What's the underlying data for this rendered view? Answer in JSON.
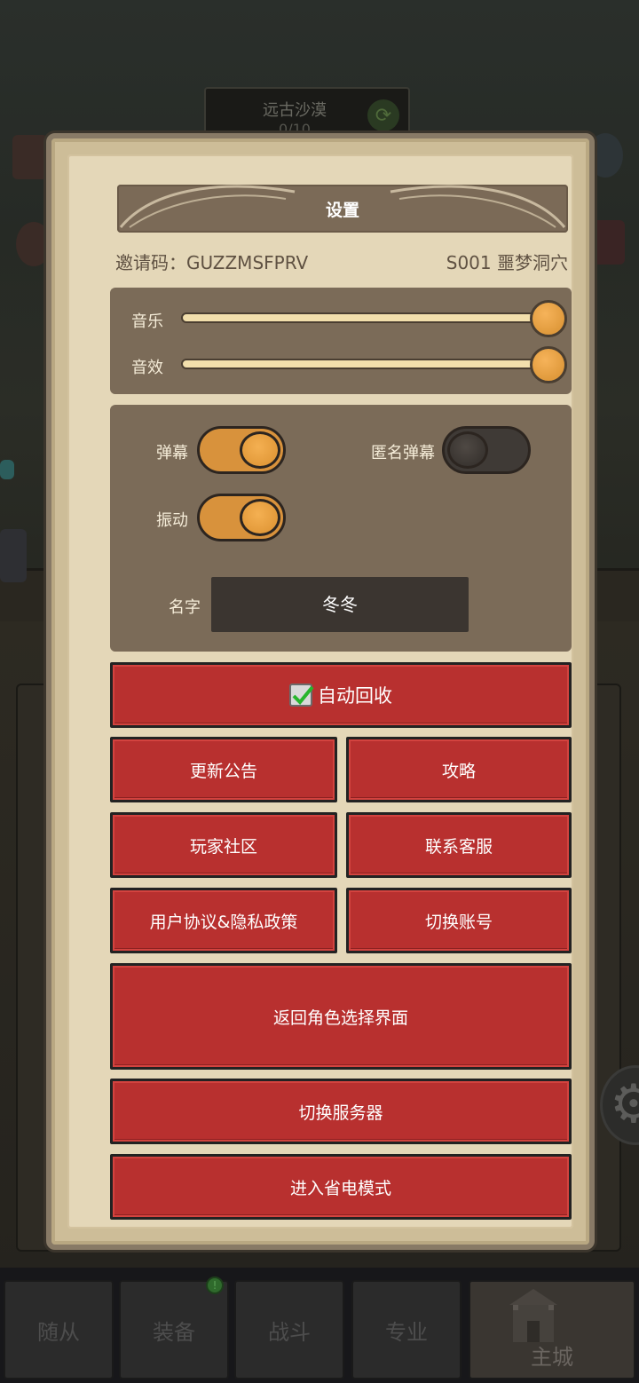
{
  "background": {
    "region": {
      "name": "远古沙漠",
      "progress": "0/10"
    },
    "bottom_nav": {
      "tabs": [
        "随从",
        "装备",
        "战斗",
        "专业",
        "主城"
      ],
      "badge": "!"
    }
  },
  "settings": {
    "title": "设置",
    "invite_code": "邀请码：GUZZMSFPRV",
    "server": "S001 噩梦洞穴",
    "audio": {
      "music_label": "音乐",
      "music_level": 1.0,
      "sfx_label": "音效",
      "sfx_level": 1.0
    },
    "toggles": {
      "danmaku_label": "弹幕",
      "danmaku_on": true,
      "anon_danmaku_label": "匿名弹幕",
      "anon_danmaku_on": false,
      "vibration_label": "振动",
      "vibration_on": true
    },
    "name_label": "名字",
    "name_value": "冬冬",
    "auto_recycle": {
      "label": "自动回收",
      "checked": true
    },
    "buttons": {
      "update_notice": "更新公告",
      "guide": "攻略",
      "community": "玩家社区",
      "customer_service": "联系客服",
      "privacy": "用户协议&隐私政策",
      "switch_account": "切换账号",
      "back_to_role_select": "返回角色选择界面",
      "switch_server": "切换服务器",
      "power_save": "进入省电模式"
    }
  },
  "colors": {
    "button_red": "#b8302f",
    "panel_brown": "#7b6b58",
    "parchment": "#e4d7b8",
    "toggle_orange": "#d8923c"
  }
}
